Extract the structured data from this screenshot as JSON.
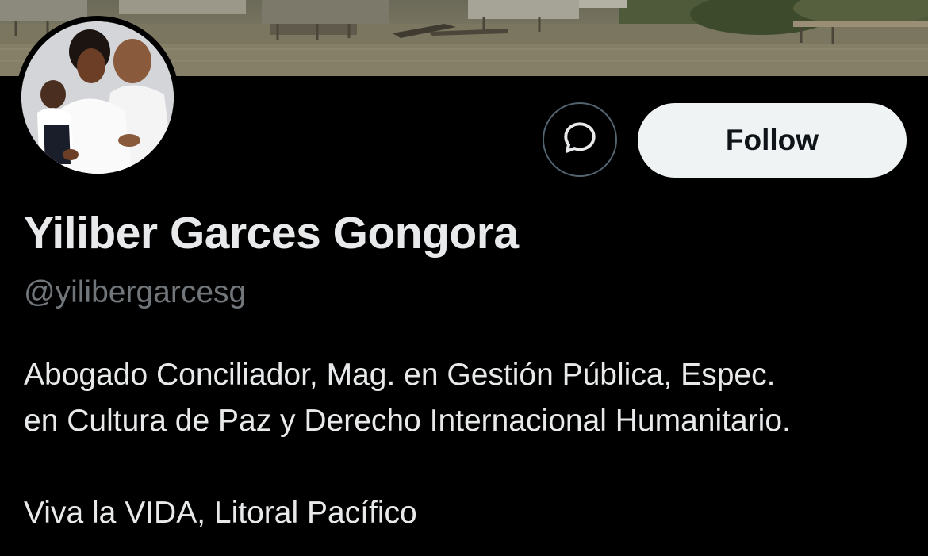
{
  "profile": {
    "display_name": "Yiliber Garces Gongora",
    "handle": "@yilibergarcesg",
    "bio_lines": [
      "Abogado Conciliador, Mag. en Gestión Pública, Espec.",
      "en Cultura de Paz y Derecho Internacional Humanitario.",
      "Viva la VIDA, Litoral Pacífico"
    ]
  },
  "actions": {
    "message_icon": "chat-bubble-icon",
    "follow_label": "Follow"
  },
  "colors": {
    "background": "#000000",
    "primary_text": "#e7e9ea",
    "secondary_text": "#71767b",
    "follow_button_bg": "#eff3f4",
    "follow_button_text": "#0f1419",
    "outline": "#536471"
  }
}
